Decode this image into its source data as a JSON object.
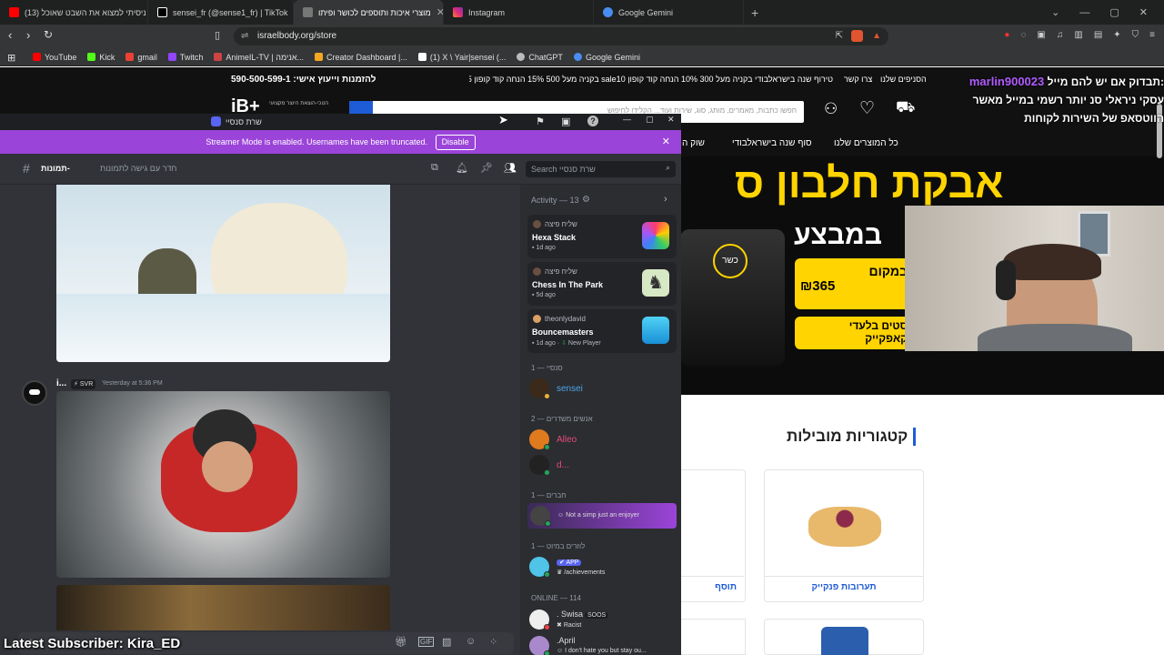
{
  "browser": {
    "tabs": [
      {
        "label": "ניסיתי למצוא את השבט שאוכל (13)",
        "icon": "youtube-icon",
        "color": "#ff0000"
      },
      {
        "label": "sensei_fr (@sense1_fr) | TikTok",
        "icon": "tiktok-icon",
        "color": "#ffffff"
      },
      {
        "label": "מוצרי איכות ותוספים לכושר ופיתו",
        "icon": "site-icon",
        "color": "#888888",
        "active": true
      },
      {
        "label": "Instagram",
        "icon": "instagram-icon",
        "color": "#e1306c"
      },
      {
        "label": "Google Gemini",
        "icon": "gemini-icon",
        "color": "#4a8df0"
      }
    ],
    "url": "israelbody.org/store",
    "bookmarks": [
      {
        "label": "YouTube",
        "color": "#ff0000"
      },
      {
        "label": "Kick",
        "color": "#53fc18"
      },
      {
        "label": "gmail",
        "color": "#ea4335"
      },
      {
        "label": "Twitch",
        "color": "#9146ff"
      },
      {
        "label": "AnimeIL-TV | אנימה...",
        "color": "#cc4444"
      },
      {
        "label": "Creator Dashboard |...",
        "color": "#f5a623"
      },
      {
        "label": "(1) X \\ Yair|sensei (...",
        "color": "#ffffff"
      },
      {
        "label": "ChatGPT",
        "color": "#bbbbbb"
      },
      {
        "label": "Google Gemini",
        "color": "#4a8df0"
      }
    ]
  },
  "site": {
    "phone": "להזמנות וייעוץ אישי: 590-500-599-1",
    "top_links": [
      "הסניפים שלנו",
      "צרו קשר",
      "טירוף שנה בישראלבודי בקניה מעל 300 10% הנחה קוד קופון sale10 בקניה מעל 500 15% הנחה קוד קופון sale15"
    ],
    "search_placeholder": "חפשו כתבות, מאמרים, מותג, סוג, שירות ועוד... הקלידו לחיפוש",
    "logo": "iB+",
    "logo_sub": "הטכי-הוצאת היוצר מקצועי",
    "nav": [
      "כל המוצרים שלנו",
      "סוף שנה בישראלבודי",
      "שוק ה"
    ],
    "banner_title": "אבקת חלבון ס",
    "banner_sub": "במבצע",
    "banner_price_label": "במקום",
    "banner_price": "₪365",
    "banner_note1": "סטים בלעדי",
    "banner_note2": "קאפקייק",
    "kosher": "כשר",
    "categories_title": "קטגוריות מובילות",
    "category_1": "תערובות פנקייק",
    "category_2": "תוסף"
  },
  "stream_overlay": {
    "chat_user": "marlin900023",
    "chat_line1": ":תבדוק אם יש להם מייל",
    "chat_line2": "עסקי ניראלי סנ יותר רשמי במייל מאשר",
    "chat_line3": "הווטסאפ של השירות לקוחות",
    "latest_subscriber": "Latest Subscriber: Kira_ED"
  },
  "discord": {
    "title": "שרת סנסיי",
    "streamer_text": "Streamer Mode is enabled. Usernames have been truncated.",
    "disable_label": "Disable",
    "channel_name": "תמונות-",
    "channel_desc": "חדר עם גישה לתמונות",
    "search_placeholder": "Search שרת סנסיי",
    "message_author": "i...",
    "message_badge": "SVR",
    "message_time": "Yesterday at 5:36 PM",
    "activity_header": "Activity — 13",
    "activities": [
      {
        "user": "שליח פיצה",
        "game": "Hexa Stack",
        "time": "1d ago",
        "extra": ""
      },
      {
        "user": "שליח פיצה",
        "game": "Chess In The Park",
        "time": "5d ago",
        "extra": ""
      },
      {
        "user": "theonlydavid",
        "game": "Bouncemasters",
        "time": "1d ago",
        "extra": "New Player"
      }
    ],
    "sections": [
      {
        "header": "סנסיי — 1",
        "members": [
          {
            "name": "sensei",
            "color": "#4ea5e9"
          }
        ]
      },
      {
        "header": "אנשים משדרים — 2",
        "members": [
          {
            "name": "Alleo",
            "color": "#e84a7a"
          },
          {
            "name": "d...",
            "color": "#e84a7a"
          }
        ]
      },
      {
        "header": "חברים — 1",
        "members": [
          {
            "name": "",
            "status": "Not a simp just an enjoyer",
            "color": "#b98bf2"
          }
        ]
      },
      {
        "header": "לוזרים במיוט — 1",
        "members": [
          {
            "name": "",
            "badge": "APP",
            "status": "/achievements",
            "color": "#e84a7a"
          }
        ]
      }
    ],
    "online_header": "Online — 114",
    "online_members": [
      {
        "name": ". Swisa",
        "badge": "SOOS",
        "status": "Racist"
      },
      {
        "name": ".April",
        "badge": "",
        "status": "I don't hate you but stay ou..."
      }
    ]
  }
}
